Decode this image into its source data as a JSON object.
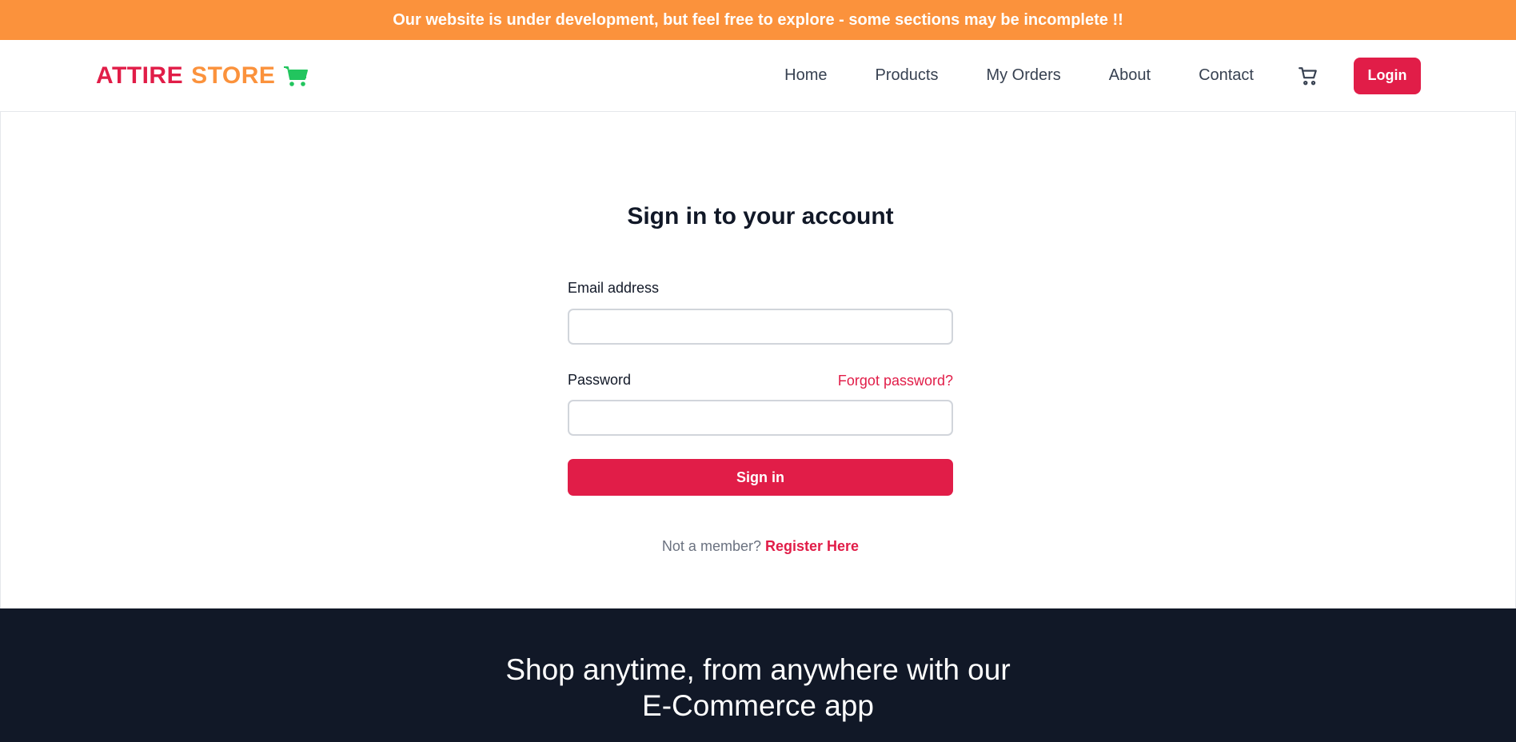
{
  "banner": {
    "text": "Our website is under development, but feel free to explore - some sections may be incomplete !!"
  },
  "logo": {
    "part1": "ATTIRE",
    "part2": "STORE",
    "icon": "shopping-cart-icon"
  },
  "nav": {
    "links": [
      "Home",
      "Products",
      "My Orders",
      "About",
      "Contact"
    ],
    "cart_icon": "cart-icon",
    "login": "Login"
  },
  "form": {
    "title": "Sign in to your account",
    "email_label": "Email address",
    "email_value": "",
    "password_label": "Password",
    "password_value": "",
    "forgot": "Forgot password?",
    "submit": "Sign in",
    "not_member": "Not a member?",
    "register": "Register Here"
  },
  "footer": {
    "line1": "Shop anytime, from anywhere with our",
    "line2": "E-Commerce app"
  },
  "colors": {
    "banner": "#fb923c",
    "accent": "#e11d48",
    "logo_cart": "#22c55e",
    "footer": "#111827"
  }
}
